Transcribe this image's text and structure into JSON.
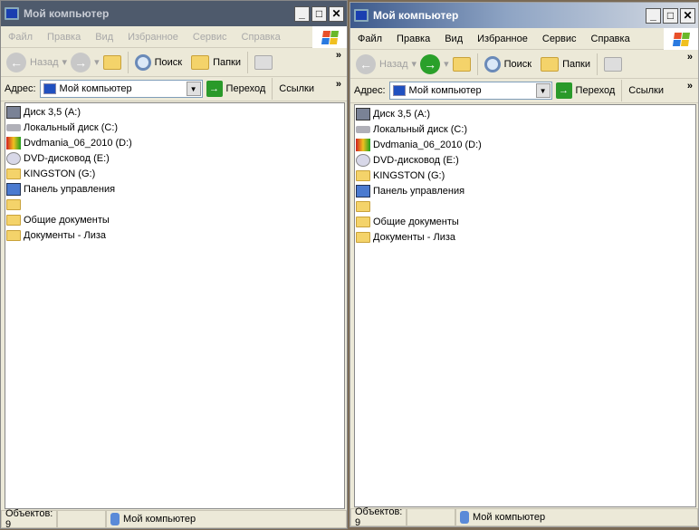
{
  "windows": [
    {
      "id": "w0",
      "state": "inactive",
      "title": "Мой компьютер"
    },
    {
      "id": "w1",
      "state": "active",
      "title": "Мой компьютер"
    }
  ],
  "menu": [
    "Файл",
    "Правка",
    "Вид",
    "Избранное",
    "Сервис",
    "Справка"
  ],
  "toolbar": {
    "back": "Назад",
    "search": "Поиск",
    "folders": "Папки",
    "more": "»"
  },
  "address": {
    "label": "Адрес:",
    "value": "Мой компьютер",
    "go": "Переход",
    "links": "Ссылки",
    "more": "»"
  },
  "items": [
    {
      "icon": "floppy",
      "label": "Диск 3,5 (A:)"
    },
    {
      "icon": "hdd",
      "label": "Локальный диск (C:)"
    },
    {
      "icon": "dvdm",
      "label": "Dvdmania_06_2010 (D:)"
    },
    {
      "icon": "dvd",
      "label": "DVD-дисковод (E:)"
    },
    {
      "icon": "folder",
      "label": "KINGSTON (G:)"
    },
    {
      "icon": "cp",
      "label": "Панель управления"
    },
    {
      "icon": "folder",
      "label": ""
    },
    {
      "icon": "folder",
      "label": "Общие документы"
    },
    {
      "icon": "folder",
      "label": "Документы - Лиза"
    }
  ],
  "status": {
    "count": "Объектов: 9",
    "location": "Мой компьютер"
  },
  "colors": {
    "active_title": "#3d5a8c",
    "inactive_title": "#4e5a6c",
    "go_green": "#2a9a2a"
  }
}
